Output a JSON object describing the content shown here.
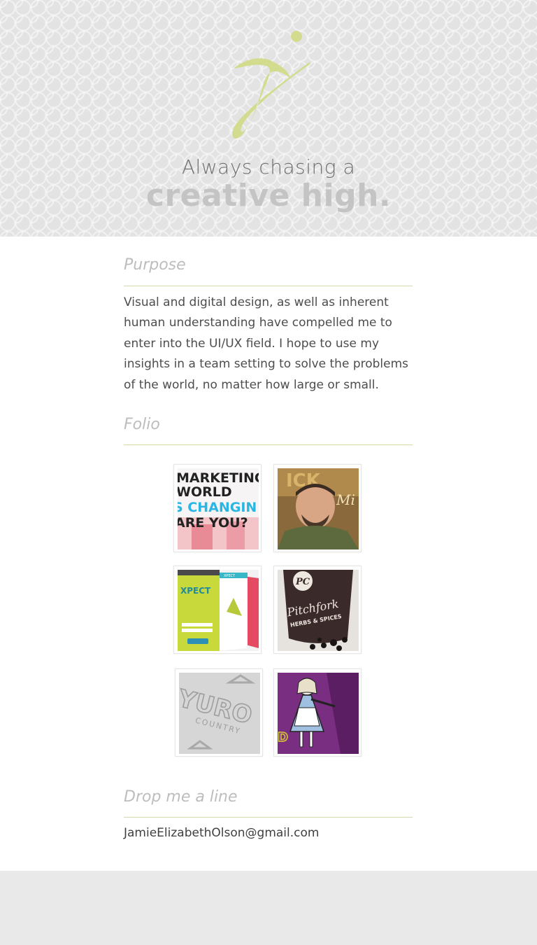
{
  "hero": {
    "tagline_line1": "Always chasing a",
    "tagline_line2": "creative high."
  },
  "purpose": {
    "title": "Purpose",
    "body": "Visual and digital design, as well as inherent human understanding have compelled me to enter into the UI/UX field. I hope to use my insights in a team setting to solve the problems of the world, no matter how large or small."
  },
  "folio": {
    "title": "Folio",
    "items": [
      {
        "lines": [
          "MARKETING",
          "WORLD",
          "S CHANGIN",
          "ARE YOU?"
        ]
      },
      {
        "lines": [
          "ICK",
          "Mi"
        ]
      },
      {
        "lines": [
          "XPECT",
          "XPECT"
        ]
      },
      {
        "lines": [
          "PC",
          "Pitchfork",
          "HERBS & SPICES"
        ]
      },
      {
        "lines": [
          "YURO",
          "COUNTRY"
        ]
      },
      {
        "lines": [
          "D"
        ]
      }
    ]
  },
  "contact": {
    "title": "Drop me a line",
    "email": "JamieElizabethOlson@gmail.com"
  },
  "colors": {
    "accent": "#d3dc8e",
    "rule": "#d5d8a8",
    "hero_bg": "#e3e3e3",
    "footer_bg": "#e9e9e9"
  }
}
